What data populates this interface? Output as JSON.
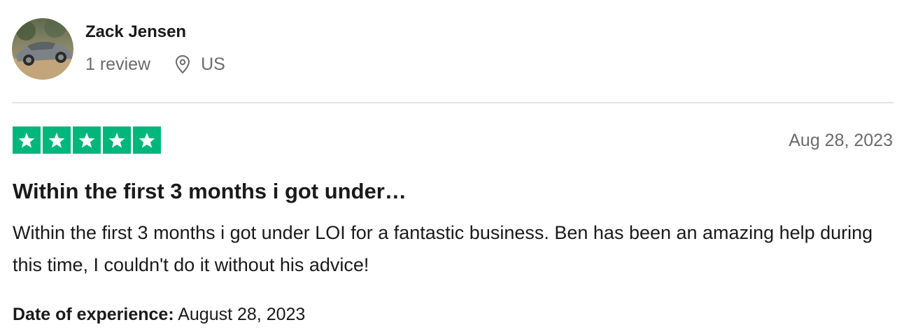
{
  "reviewer": {
    "name": "Zack Jensen",
    "review_count": "1 review",
    "location": "US",
    "location_icon": "location-pin-icon",
    "avatar": "avatar-photo"
  },
  "rating": {
    "stars": 5,
    "max_stars": 5,
    "star_color": "#00b67a",
    "icon": "star-icon"
  },
  "review": {
    "date": "Aug 28, 2023",
    "title": "Within the first 3 months i got under…",
    "body": "Within the first 3 months i got under LOI for a fantastic business. Ben has been an amazing help during this time, I couldn't do it without his advice!",
    "experience_label": "Date of experience:",
    "experience_date": "August 28, 2023"
  },
  "colors": {
    "text": "#1a1a1a",
    "muted": "#6b6b6b",
    "divider": "#e5e5dd",
    "star_green": "#00b67a"
  }
}
